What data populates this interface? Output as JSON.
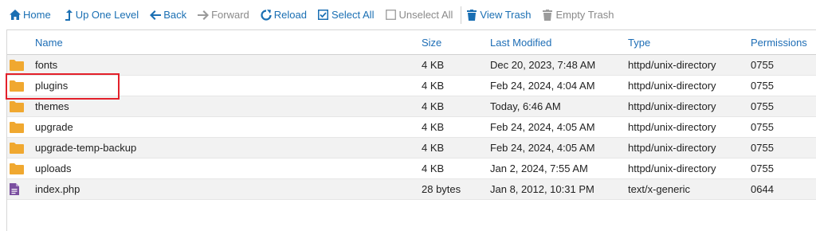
{
  "toolbar": {
    "home": "Home",
    "up_one_level": "Up One Level",
    "back": "Back",
    "forward": "Forward",
    "reload": "Reload",
    "select_all": "Select All",
    "unselect_all": "Unselect All",
    "view_trash": "View Trash",
    "empty_trash": "Empty Trash"
  },
  "table": {
    "headers": {
      "name": "Name",
      "size": "Size",
      "last_modified": "Last Modified",
      "type": "Type",
      "permissions": "Permissions"
    },
    "rows": [
      {
        "icon": "folder-icon",
        "name": "fonts",
        "size": "4 KB",
        "modified": "Dec 20, 2023, 7:48 AM",
        "type": "httpd/unix-directory",
        "perm": "0755"
      },
      {
        "icon": "folder-icon",
        "name": "plugins",
        "size": "4 KB",
        "modified": "Feb 24, 2024, 4:04 AM",
        "type": "httpd/unix-directory",
        "perm": "0755"
      },
      {
        "icon": "folder-icon",
        "name": "themes",
        "size": "4 KB",
        "modified": "Today, 6:46 AM",
        "type": "httpd/unix-directory",
        "perm": "0755"
      },
      {
        "icon": "folder-icon",
        "name": "upgrade",
        "size": "4 KB",
        "modified": "Feb 24, 2024, 4:05 AM",
        "type": "httpd/unix-directory",
        "perm": "0755"
      },
      {
        "icon": "folder-icon",
        "name": "upgrade-temp-backup",
        "size": "4 KB",
        "modified": "Feb 24, 2024, 4:05 AM",
        "type": "httpd/unix-directory",
        "perm": "0755"
      },
      {
        "icon": "folder-icon",
        "name": "uploads",
        "size": "4 KB",
        "modified": "Jan 2, 2024, 7:55 AM",
        "type": "httpd/unix-directory",
        "perm": "0755"
      },
      {
        "icon": "file-icon",
        "name": "index.php",
        "size": "28 bytes",
        "modified": "Jan 8, 2012, 10:31 PM",
        "type": "text/x-generic",
        "perm": "0644"
      }
    ]
  },
  "colors": {
    "link": "#1a6fb3",
    "folder": "#f0a830",
    "file": "#7b4fa0",
    "highlight": "#e3202a"
  }
}
